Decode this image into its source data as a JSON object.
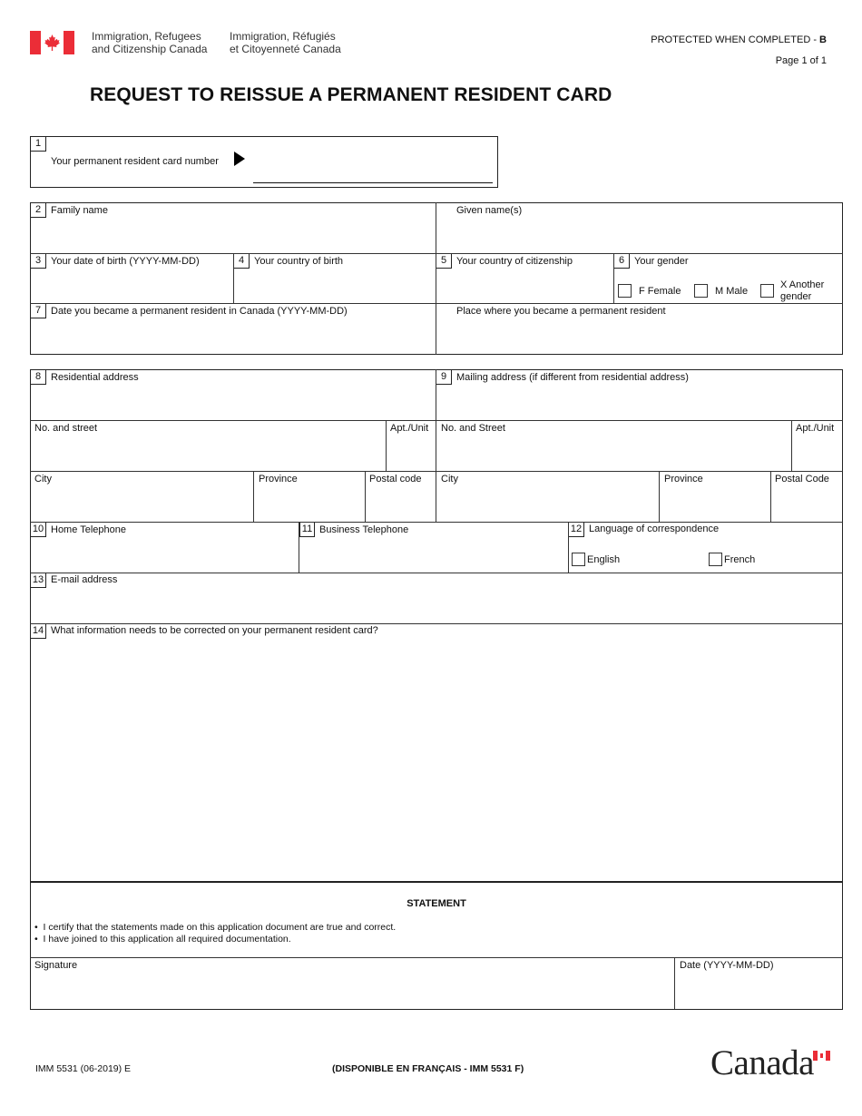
{
  "header": {
    "department_en_line1": "Immigration, Refugees",
    "department_en_line2": "and Citizenship Canada",
    "department_fr_line1": "Immigration, Réfugiés",
    "department_fr_line2": "et Citoyenneté Canada",
    "protected_label": "PROTECTED WHEN COMPLETED - ",
    "protected_level": "B",
    "page_indicator": "Page 1 of 1",
    "brand_color": "#eb2d37"
  },
  "title": "REQUEST TO REISSUE A PERMANENT RESIDENT CARD",
  "section1": {
    "num": "1",
    "label": "Your permanent resident card number",
    "value": ""
  },
  "section2": {
    "family_name": {
      "num": "2",
      "label": "Family name",
      "value": ""
    },
    "given_names": {
      "label": "Given name(s)",
      "value": ""
    },
    "dob": {
      "num": "3",
      "label": "Your date of birth (YYYY-MM-DD)",
      "value": ""
    },
    "country_birth": {
      "num": "4",
      "label": "Your country of birth",
      "value": ""
    },
    "country_citizenship": {
      "num": "5",
      "label": "Your country of citizenship",
      "value": ""
    },
    "gender": {
      "num": "6",
      "label": "Your gender",
      "options": [
        {
          "label": "F Female",
          "checked": false
        },
        {
          "label": "M Male",
          "checked": false
        },
        {
          "label_line1": "X Another",
          "label_line2": "gender",
          "checked": false
        }
      ]
    },
    "pr_date": {
      "num": "7",
      "label": "Date you became a permanent resident in Canada (YYYY-MM-DD)",
      "value": ""
    },
    "pr_place": {
      "label": "Place where you became a permanent resident",
      "value": ""
    }
  },
  "section3": {
    "residential": {
      "num": "8",
      "label": "Residential address",
      "street_label": "No. and street",
      "apt_label": "Apt./Unit",
      "city_label": "City",
      "province_label": "Province",
      "postal_label": "Postal code"
    },
    "mailing": {
      "num": "9",
      "label": "Mailing address (if different from residential address)",
      "street_label": "No. and Street",
      "apt_label": "Apt./Unit",
      "city_label": "City",
      "province_label": "Province",
      "postal_label": "Postal Code"
    },
    "home_phone": {
      "num": "10",
      "label": "Home Telephone",
      "value": ""
    },
    "business_phone": {
      "num": "11",
      "label": "Business Telephone",
      "value": ""
    },
    "language": {
      "num": "12",
      "label": "Language of correspondence",
      "options": [
        {
          "label": "English",
          "checked": false
        },
        {
          "label": "French",
          "checked": false
        }
      ]
    },
    "email": {
      "num": "13",
      "label": "E-mail address",
      "value": ""
    },
    "correction": {
      "num": "14",
      "label": "What information needs to be corrected on your permanent resident card?",
      "value": ""
    },
    "statement": {
      "title": "STATEMENT",
      "items": [
        "I certify that the statements made on this application document are true and correct.",
        "I have joined to this application all required documentation."
      ]
    },
    "signature_label": "Signature",
    "date_label": "Date (YYYY-MM-DD)"
  },
  "footer": {
    "form_code": "IMM 5531 (06-2019) E",
    "french_notice": "(DISPONIBLE EN FRANÇAIS - IMM 5531 F)",
    "wordmark": "Canada"
  }
}
